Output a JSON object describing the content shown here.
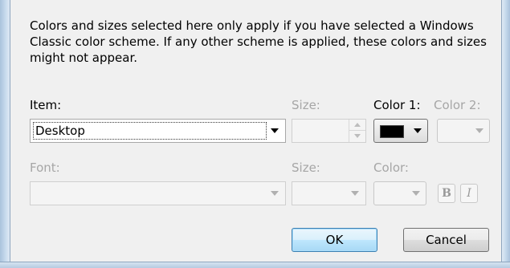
{
  "info_text": "Colors and sizes selected here only apply if you have selected a Windows Classic color scheme. If any other scheme is applied, these colors and sizes might not appear.",
  "labels": {
    "item": "Item:",
    "size": "Size:",
    "color1": "Color 1:",
    "color2": "Color 2:",
    "font": "Font:",
    "font_size": "Size:",
    "font_color": "Color:"
  },
  "item_combo": {
    "selected": "Desktop"
  },
  "size_spinner": {
    "value": ""
  },
  "color1": {
    "swatch": "#000000"
  },
  "font_combo": {
    "selected": ""
  },
  "style_buttons": {
    "bold": "B",
    "italic": "I"
  },
  "buttons": {
    "ok": "OK",
    "cancel": "Cancel"
  }
}
